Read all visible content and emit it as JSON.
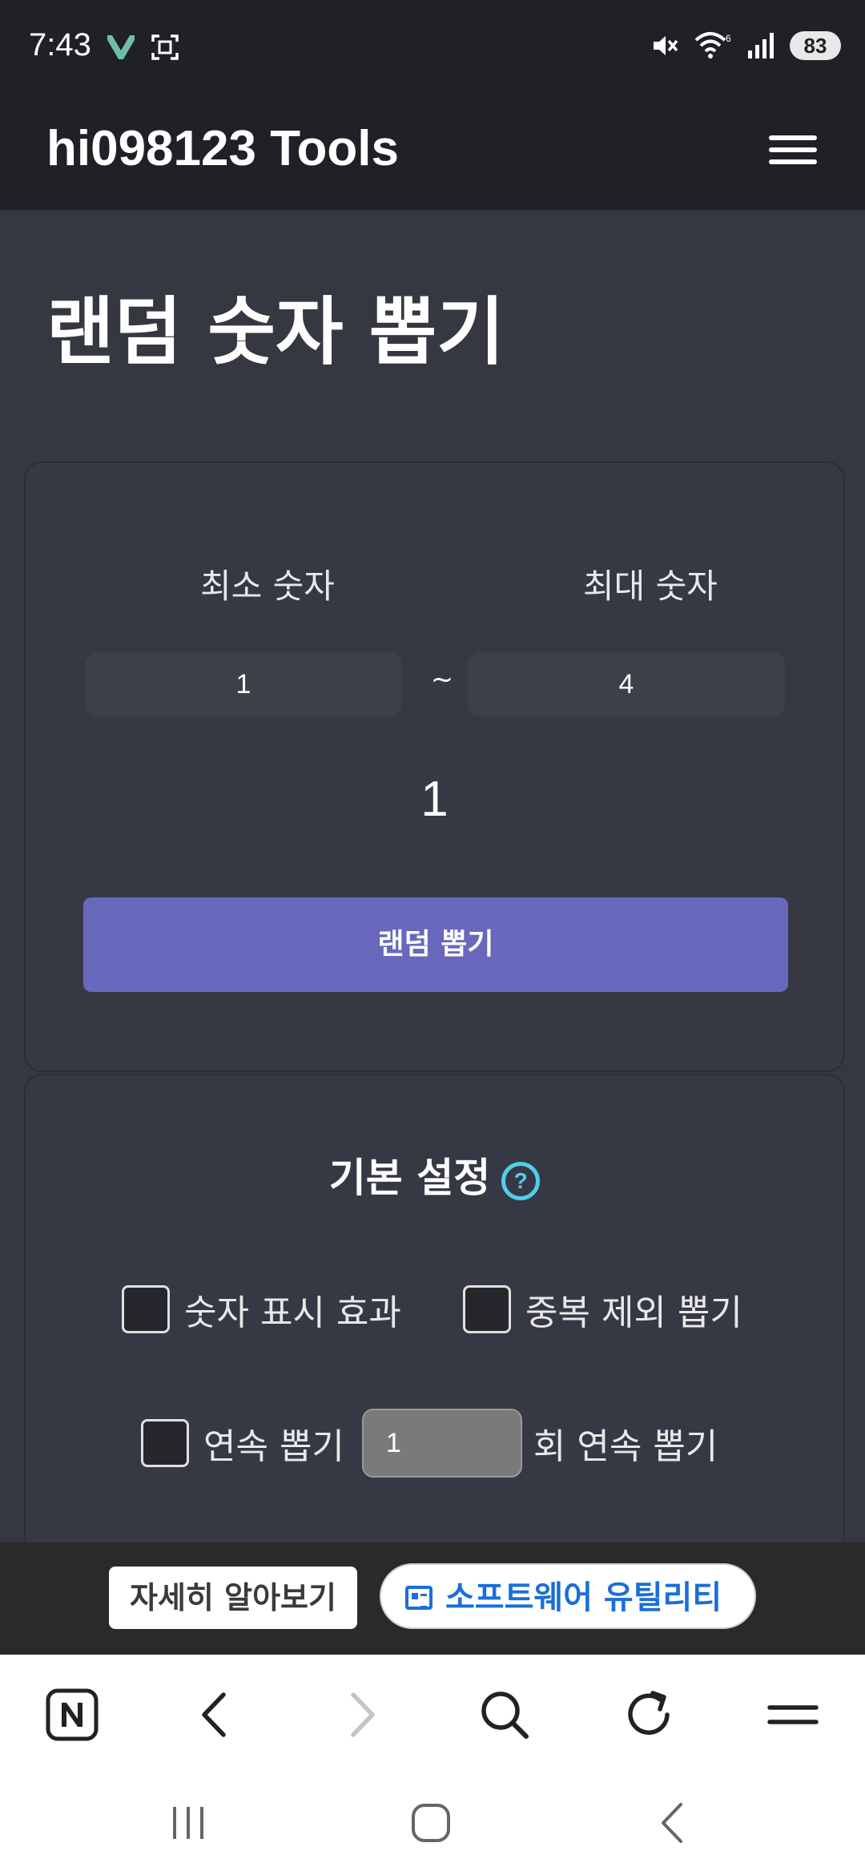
{
  "status_bar": {
    "time": "7:43",
    "battery": "83",
    "icons": [
      "v-app-icon",
      "screenshot-icon",
      "mute-icon",
      "wifi-icon",
      "signal-icon",
      "battery-icon"
    ]
  },
  "header": {
    "brand": "hi098123 Tools",
    "menu_icon": "hamburger-menu-icon"
  },
  "page": {
    "title": "랜덤 숫자 뽑기"
  },
  "range": {
    "min_label": "최소 숫자",
    "max_label": "최대 숫자",
    "min_value": "1",
    "max_value": "4",
    "separator": "~"
  },
  "result": {
    "value": "1"
  },
  "draw_button": {
    "label": "랜덤 뽑기"
  },
  "settings": {
    "title": "기본 설정",
    "help_icon_glyph": "?",
    "options": {
      "number_effect": "숫자 표시 효과",
      "no_duplicates": "중복 제외 뽑기",
      "consecutive": "연속 뽑기",
      "consecutive_suffix": "회 연속 뽑기",
      "consecutive_count": "1"
    }
  },
  "ad": {
    "learn_more": "자세히 알아보기",
    "category": "소프트웨어 유틸리티"
  },
  "browser_toolbar": {
    "icons": [
      "naver-n-icon",
      "back-arrow-icon",
      "forward-arrow-icon",
      "search-icon",
      "reload-icon",
      "menu-icon"
    ]
  },
  "system_nav": {
    "icons": [
      "recent-apps-icon",
      "home-icon",
      "back-icon"
    ]
  },
  "colors": {
    "background": "#353841",
    "header": "#1f2126",
    "accent_button": "#6868bd",
    "help_icon": "#4fd0e8",
    "ad_link": "#1a6fd8"
  }
}
